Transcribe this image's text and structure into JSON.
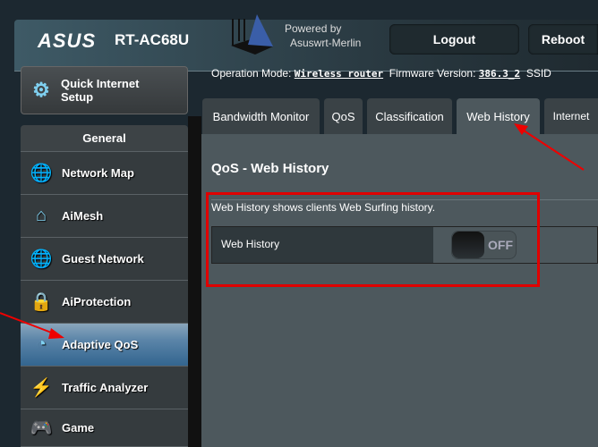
{
  "header": {
    "brand": "ASUS",
    "model": "RT-AC68U",
    "powered_by": "Powered by",
    "firmware_name": "Asuswrt-Merlin",
    "logout": "Logout",
    "reboot": "Reboot"
  },
  "status": {
    "op_mode_label": "Operation Mode:",
    "op_mode": "Wireless router",
    "fw_label": "Firmware Version:",
    "fw": "386.3_2",
    "ssid_label": "SSID"
  },
  "sidebar": {
    "quick_setup": "Quick Internet Setup",
    "section": "General",
    "items": [
      {
        "label": "Network Map",
        "icon": "globe-pin-icon"
      },
      {
        "label": "AiMesh",
        "icon": "aimesh-icon"
      },
      {
        "label": "Guest Network",
        "icon": "guest-network-icon"
      },
      {
        "label": "AiProtection",
        "icon": "shield-lock-icon"
      },
      {
        "label": "Adaptive QoS",
        "icon": "speedometer-icon",
        "selected": true
      },
      {
        "label": "Traffic Analyzer",
        "icon": "pulse-icon"
      },
      {
        "label": "Game",
        "icon": "gamepad-icon"
      }
    ]
  },
  "tabs": [
    {
      "label": "Bandwidth Monitor"
    },
    {
      "label": "QoS"
    },
    {
      "label": "Classification"
    },
    {
      "label": "Web History",
      "active": true
    },
    {
      "label": "Internet"
    }
  ],
  "main": {
    "title": "QoS - Web History",
    "description": "Web History shows clients Web Surfing history.",
    "setting_label": "Web History",
    "toggle_state": "OFF"
  },
  "colors": {
    "highlight": "#e00000",
    "selected": "#33658f"
  }
}
